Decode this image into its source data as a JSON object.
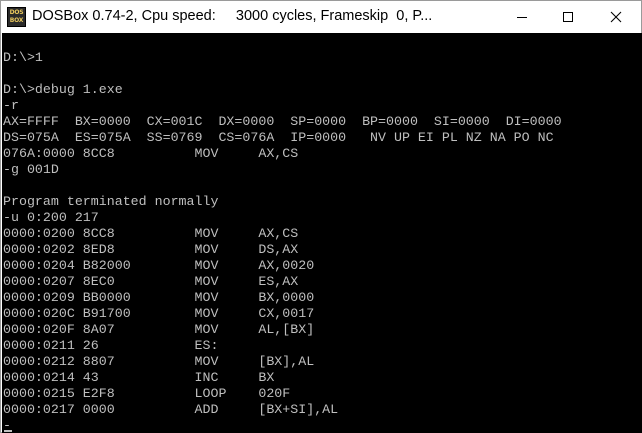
{
  "window": {
    "title": "DOSBox 0.74-2, Cpu speed:     3000 cycles, Frameskip  0, P...",
    "icon_lines": [
      "DOS",
      "BOX"
    ]
  },
  "terminal": {
    "lines": [
      "",
      "D:\\>1",
      "",
      "D:\\>debug 1.exe",
      "-r",
      "AX=FFFF  BX=0000  CX=001C  DX=0000  SP=0000  BP=0000  SI=0000  DI=0000",
      "DS=075A  ES=075A  SS=0769  CS=076A  IP=0000   NV UP EI PL NZ NA PO NC",
      "076A:0000 8CC8          MOV     AX,CS",
      "-g 001D",
      "",
      "Program terminated normally",
      "-u 0:200 217",
      "0000:0200 8CC8          MOV     AX,CS",
      "0000:0202 8ED8          MOV     DS,AX",
      "0000:0204 B82000        MOV     AX,0020",
      "0000:0207 8EC0          MOV     ES,AX",
      "0000:0209 BB0000        MOV     BX,0000",
      "0000:020C B91700        MOV     CX,0017",
      "0000:020F 8A07          MOV     AL,[BX]",
      "0000:0211 26            ES:",
      "0000:0212 8807          MOV     [BX],AL",
      "0000:0214 43            INC     BX",
      "0000:0215 E2F8          LOOP    020F",
      "0000:0217 0000          ADD     [BX+SI],AL",
      "-"
    ]
  }
}
